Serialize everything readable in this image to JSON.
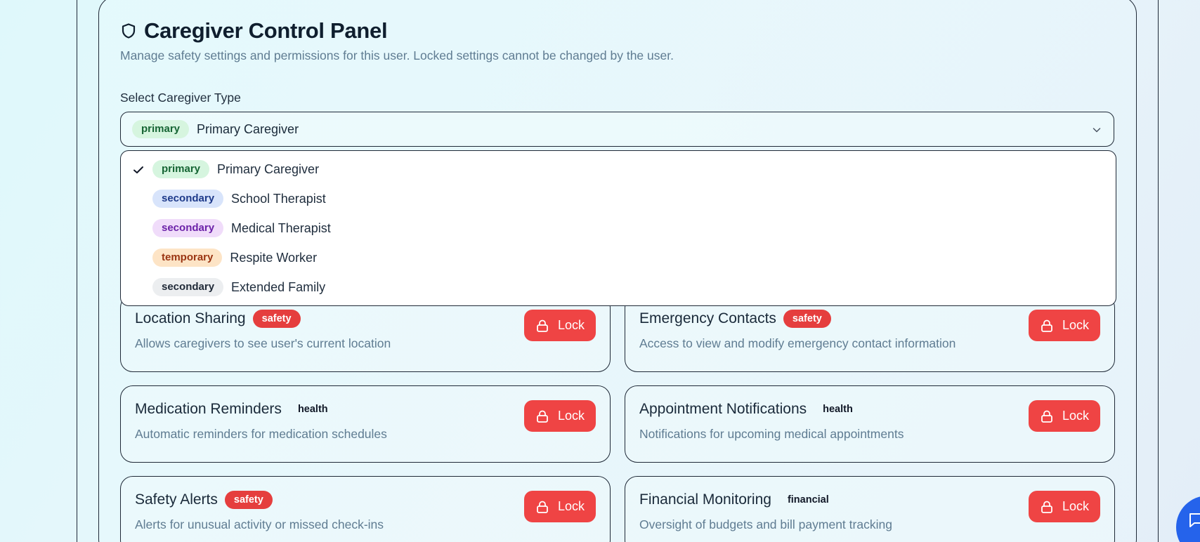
{
  "header": {
    "title": "Caregiver Control Panel",
    "subtitle": "Manage safety settings and permissions for this user. Locked settings cannot be changed by the user."
  },
  "caregiver_select": {
    "label": "Select Caregiver Type",
    "selected_badge": "primary",
    "selected_value": "Primary Caregiver",
    "options": [
      {
        "badge": "primary",
        "label": "Primary Caregiver",
        "selected": true
      },
      {
        "badge": "secondary",
        "label": "School Therapist"
      },
      {
        "badge": "secondary",
        "label": "Medical Therapist"
      },
      {
        "badge": "temporary",
        "label": "Respite Worker"
      },
      {
        "badge": "secondary",
        "label": "Extended Family"
      }
    ]
  },
  "settings": [
    {
      "title": "Location Sharing",
      "tag": "safety",
      "description": "Allows caregivers to see user's current location",
      "button": "Lock"
    },
    {
      "title": "Emergency Contacts",
      "tag": "safety",
      "description": "Access to view and modify emergency contact information",
      "button": "Lock"
    },
    {
      "title": "Medication Reminders",
      "tag": "health",
      "description": "Automatic reminders for medication schedules",
      "button": "Lock"
    },
    {
      "title": "Appointment Notifications",
      "tag": "health",
      "description": "Notifications for upcoming medical appointments",
      "button": "Lock"
    },
    {
      "title": "Safety Alerts",
      "tag": "safety",
      "description": "Alerts for unusual activity or missed check-ins",
      "button": "Lock"
    },
    {
      "title": "Financial Monitoring",
      "tag": "financial",
      "description": "Oversight of budgets and bill payment tracking",
      "button": "Lock"
    }
  ],
  "colors": {
    "lock_button": "#ef4444",
    "safety_tag": "#e53e3e",
    "chat_button": "#2563eb"
  },
  "icons": {
    "title": "shield-icon",
    "select": "chevron-down-icon",
    "selected_option": "check-icon",
    "lock": "lock-icon",
    "chat": "chat-icon"
  }
}
